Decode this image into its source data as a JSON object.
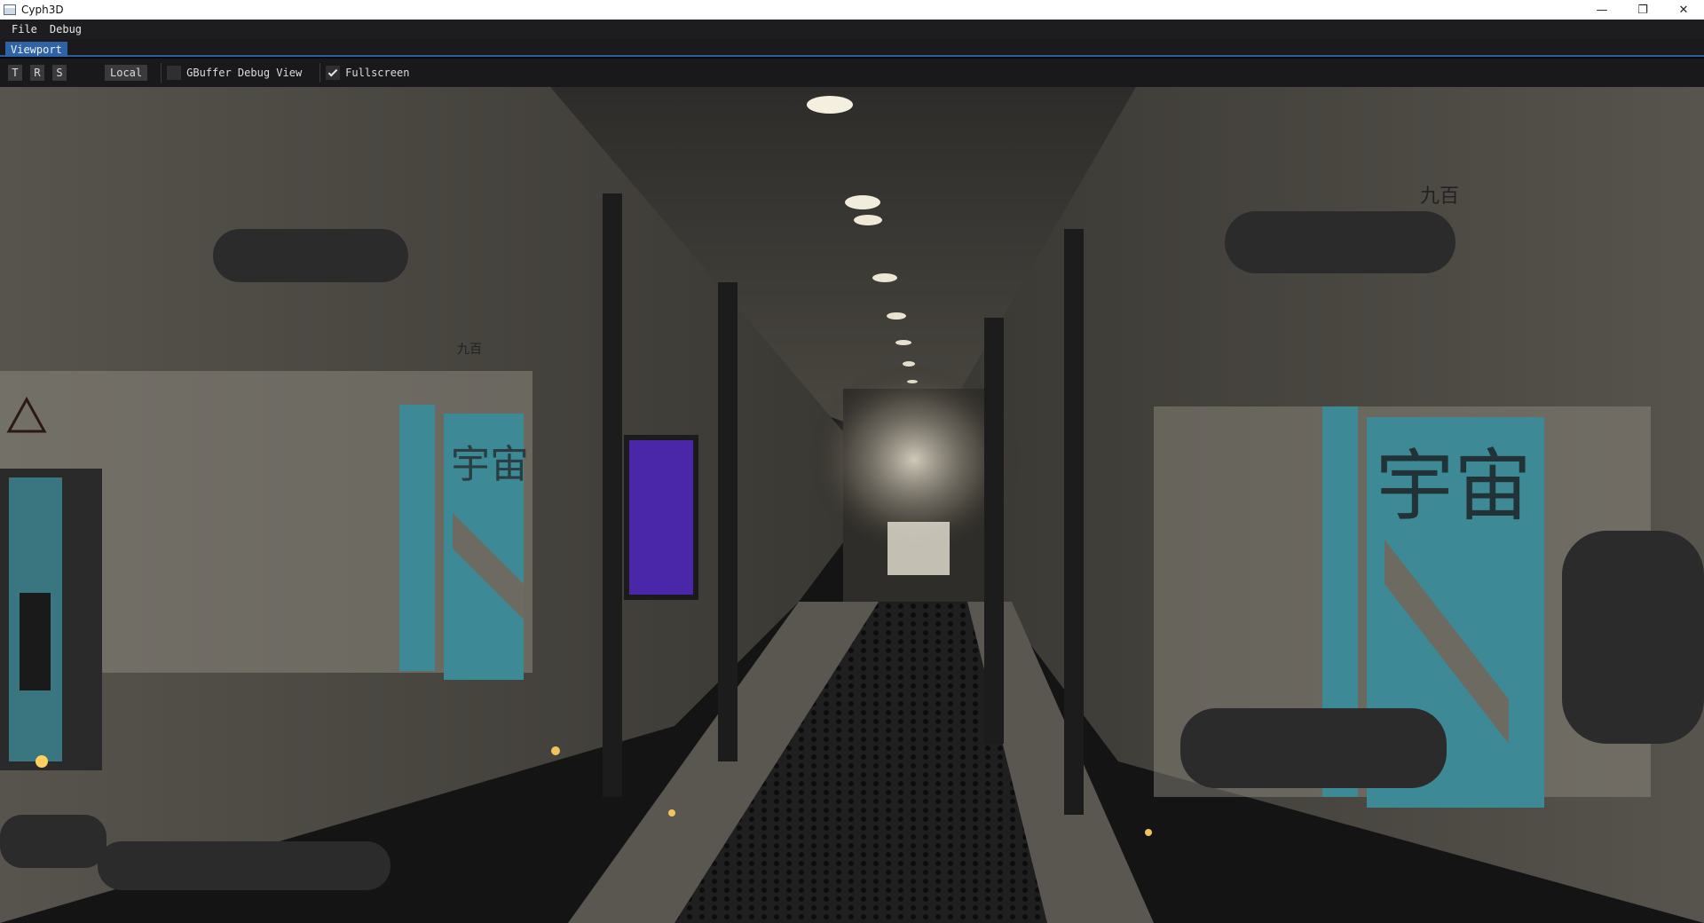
{
  "window": {
    "title": "Cyph3D",
    "controls": {
      "minimize": "—",
      "maximize": "❐",
      "close": "✕"
    }
  },
  "menubar": {
    "items": [
      {
        "label": "File"
      },
      {
        "label": "Debug"
      }
    ]
  },
  "tabs": [
    {
      "label": "Viewport",
      "active": true
    }
  ],
  "toolbar": {
    "translate_label": "T",
    "rotate_label": "R",
    "scale_label": "S",
    "space_label": "Local",
    "gbuffer_debug": {
      "label": "GBuffer Debug View",
      "checked": false
    },
    "fullscreen": {
      "label": "Fullscreen",
      "checked": true
    }
  },
  "viewport": {
    "scene_signs": {
      "left_kanji": "宇宙",
      "right_kanji": "宇宙",
      "left_small": "九百",
      "right_small": "九百"
    }
  },
  "colors": {
    "accent": "#2e63a8",
    "teal_panel": "#3d8a96",
    "wall": "#6e6a60",
    "floor": "#1c1c1e"
  }
}
